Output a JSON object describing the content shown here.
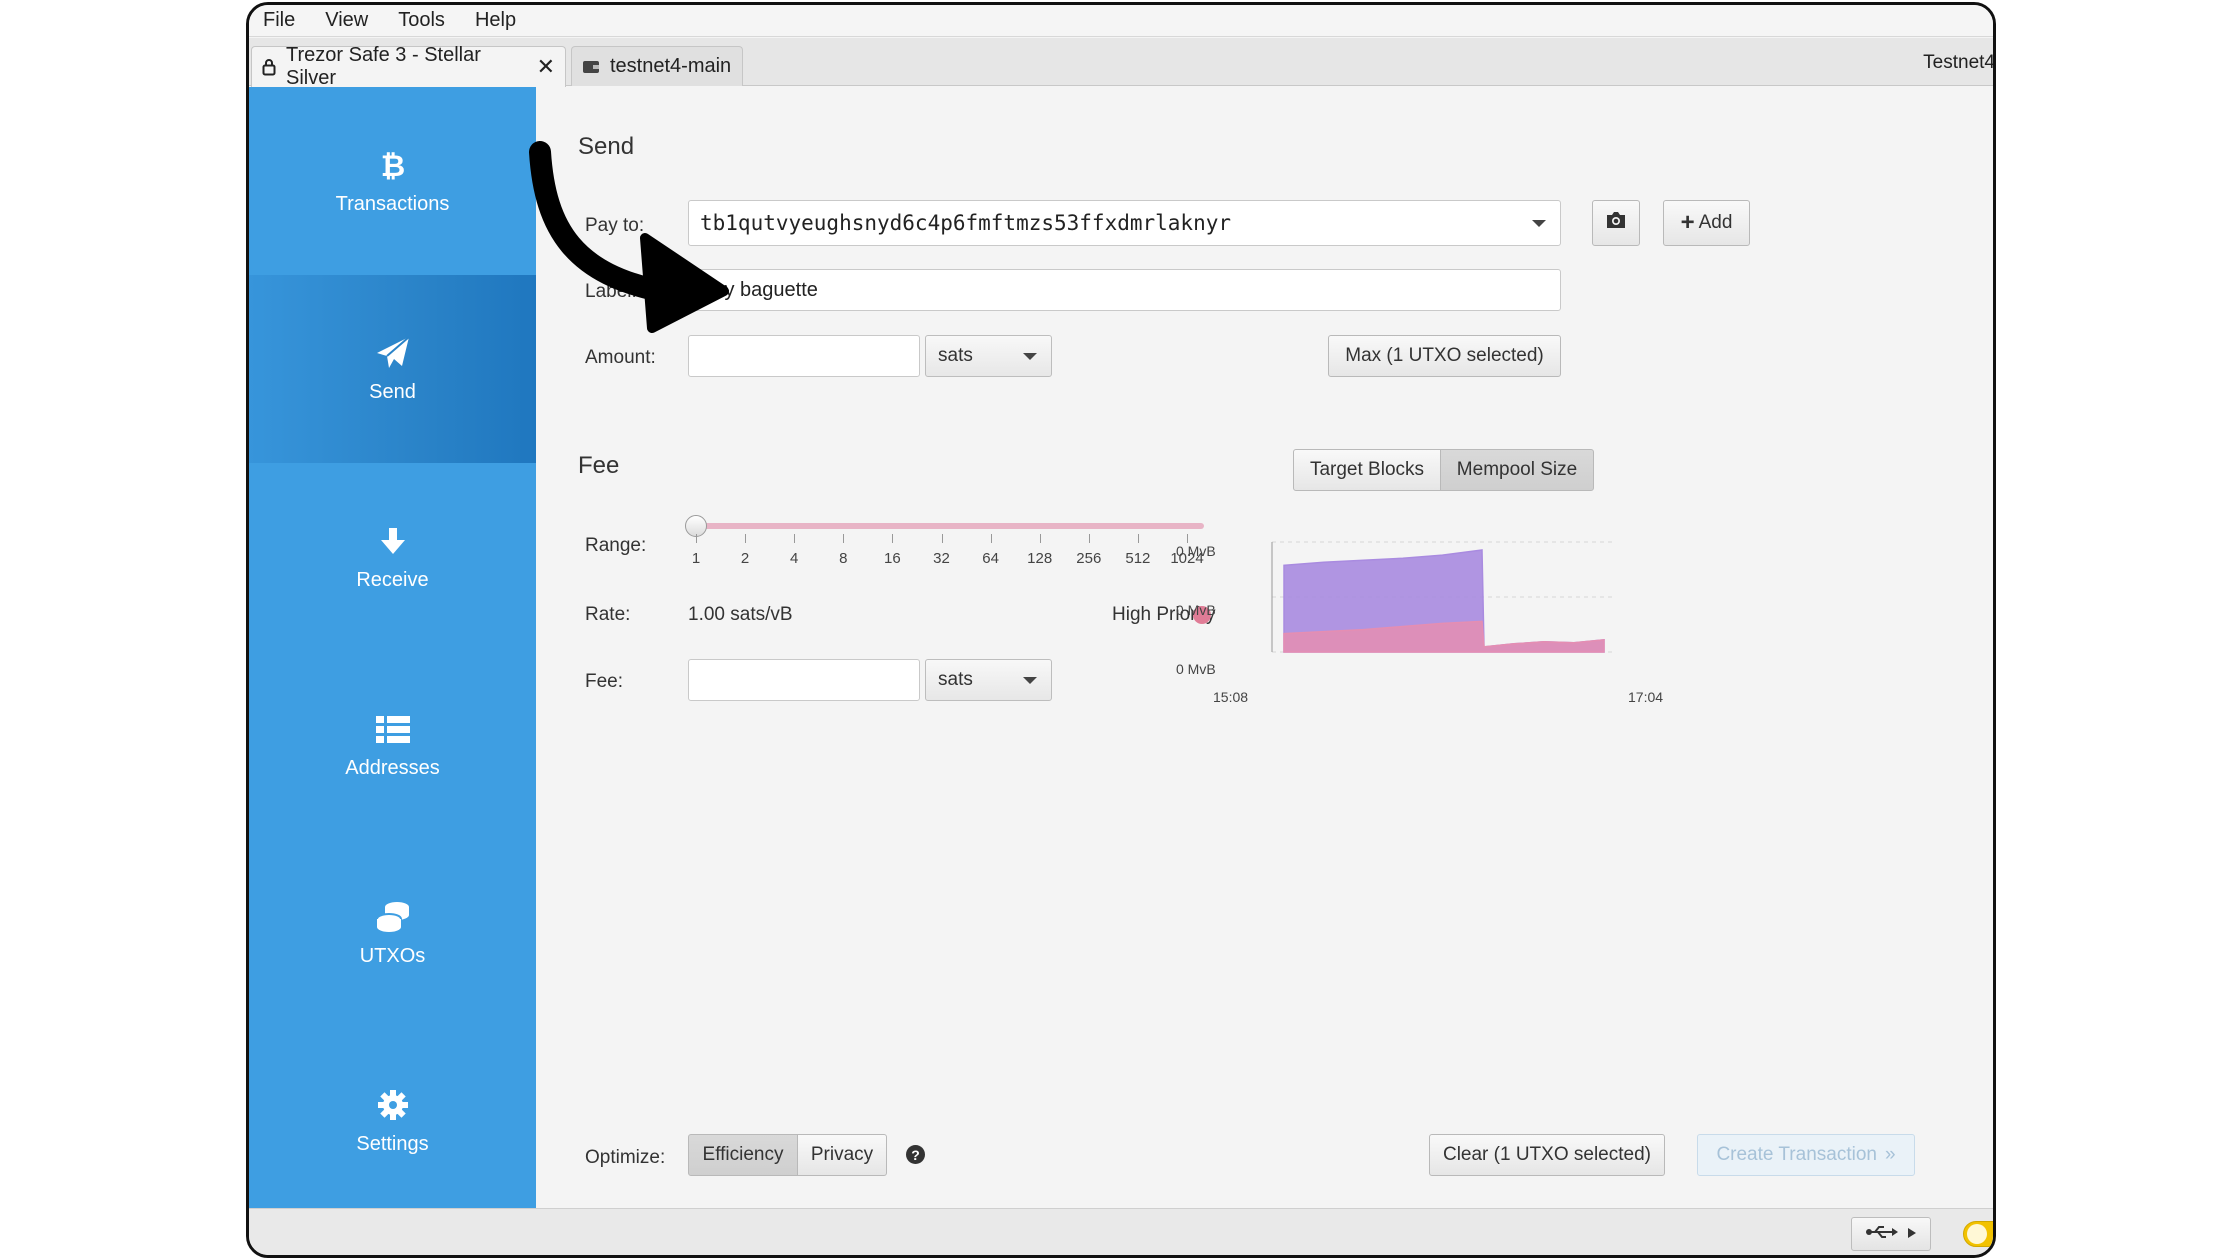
{
  "menu": [
    "File",
    "View",
    "Tools",
    "Help"
  ],
  "tabs": {
    "active": {
      "label": "Trezor Safe 3 - Stellar Silver",
      "close": "✕"
    },
    "inactive": {
      "label": "testnet4-main"
    },
    "network_label": "Testnet4"
  },
  "sidebar": {
    "items": [
      {
        "label": "Transactions",
        "icon": "bitcoin-icon"
      },
      {
        "label": "Send",
        "icon": "paper-plane-icon"
      },
      {
        "label": "Receive",
        "icon": "arrow-down-icon"
      },
      {
        "label": "Addresses",
        "icon": "list-icon"
      },
      {
        "label": "UTXOs",
        "icon": "coins-icon"
      },
      {
        "label": "Settings",
        "icon": "gear-icon"
      }
    ],
    "selected": "Send"
  },
  "send": {
    "title": "Send",
    "pay_to_label": "Pay to:",
    "pay_to_value": "tb1qutvyeughsnyd6c4p6fmftmzs53ffxdmrlaknyr",
    "label_label": "Label:",
    "label_value": "Buy baguette",
    "amount_label": "Amount:",
    "amount_value": "",
    "amount_unit": "sats",
    "max_button": "Max (1 UTXO selected)",
    "add_button": "Add",
    "add_button_icon": "+"
  },
  "fee": {
    "title": "Fee",
    "range_label": "Range:",
    "range_ticks": [
      "1",
      "2",
      "4",
      "8",
      "16",
      "32",
      "64",
      "128",
      "256",
      "512",
      "1024"
    ],
    "range_value": "1",
    "rate_label": "Rate:",
    "rate_value": "1.00 sats/vB",
    "priority_label": "High Priority",
    "fee_label": "Fee:",
    "fee_value": "",
    "fee_unit": "sats",
    "toggle_target_blocks": "Target Blocks",
    "toggle_mempool_size": "Mempool Size",
    "toggle_selected": "Mempool Size"
  },
  "chart_data": {
    "type": "area",
    "title": "",
    "xlabel": "",
    "ylabel": "",
    "x_ticks": [
      "15:08",
      "17:04"
    ],
    "y_ticks": [
      "0 MvB",
      "0 MvB",
      "0 MvB"
    ],
    "grid": true,
    "series_colors": [
      "#a98be0",
      "#e58eb2"
    ],
    "series": [
      {
        "values": [
          0.85,
          0.88,
          0.9,
          0.92,
          0.95,
          1.0,
          0.05,
          0.08,
          0.1,
          0.09,
          0.12
        ]
      },
      {
        "values": [
          0.18,
          0.2,
          0.22,
          0.25,
          0.28,
          0.3,
          0.05,
          0.08,
          0.1,
          0.09,
          0.12
        ]
      }
    ]
  },
  "optimize": {
    "label": "Optimize:",
    "efficiency": "Efficiency",
    "privacy": "Privacy",
    "selected": "Efficiency",
    "help": "?"
  },
  "actions": {
    "clear": "Clear (1 UTXO selected)",
    "create": "Create Transaction",
    "create_suffix": "»"
  },
  "colors": {
    "sidebar": "#3e9ee2",
    "sidebar_selected": "#2a83c8",
    "priority": "#e07c96",
    "slider": "#e8b4c6"
  }
}
